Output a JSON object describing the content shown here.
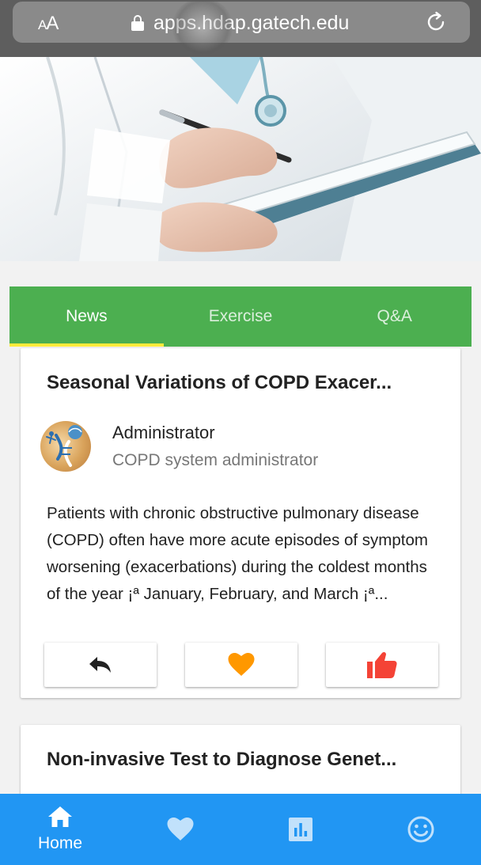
{
  "browser": {
    "text_size_label": "AA",
    "url": "apps.hdap.gatech.edu"
  },
  "tabs": [
    {
      "label": "News",
      "active": true
    },
    {
      "label": "Exercise",
      "active": false
    },
    {
      "label": "Q&A",
      "active": false
    }
  ],
  "articles": [
    {
      "title": "Seasonal Variations of COPD Exacer...",
      "author_name": "Administrator",
      "author_role": "COPD system administrator",
      "excerpt": "Patients with chronic obstructive pulmonary disease (COPD) often have more acute episodes of symptom worsening (exacerbations) during the coldest months of the year ¡ª January, February, and March ¡ª...",
      "actions": [
        {
          "icon": "reply-icon",
          "color": "#222222"
        },
        {
          "icon": "heart-icon",
          "color": "#ff9800"
        },
        {
          "icon": "thumbs-up-icon",
          "color": "#f44336"
        }
      ]
    },
    {
      "title": "Non-invasive Test to Diagnose Genet..."
    }
  ],
  "bottom_nav": [
    {
      "icon": "home-icon",
      "label": "Home",
      "active": true
    },
    {
      "icon": "heart-icon",
      "label": "",
      "active": false
    },
    {
      "icon": "chart-icon",
      "label": "",
      "active": false
    },
    {
      "icon": "smiley-icon",
      "label": "",
      "active": false
    }
  ],
  "colors": {
    "tab_bar": "#4caf50",
    "tab_indicator": "#ffeb3b",
    "bottom_nav": "#2196f3"
  }
}
